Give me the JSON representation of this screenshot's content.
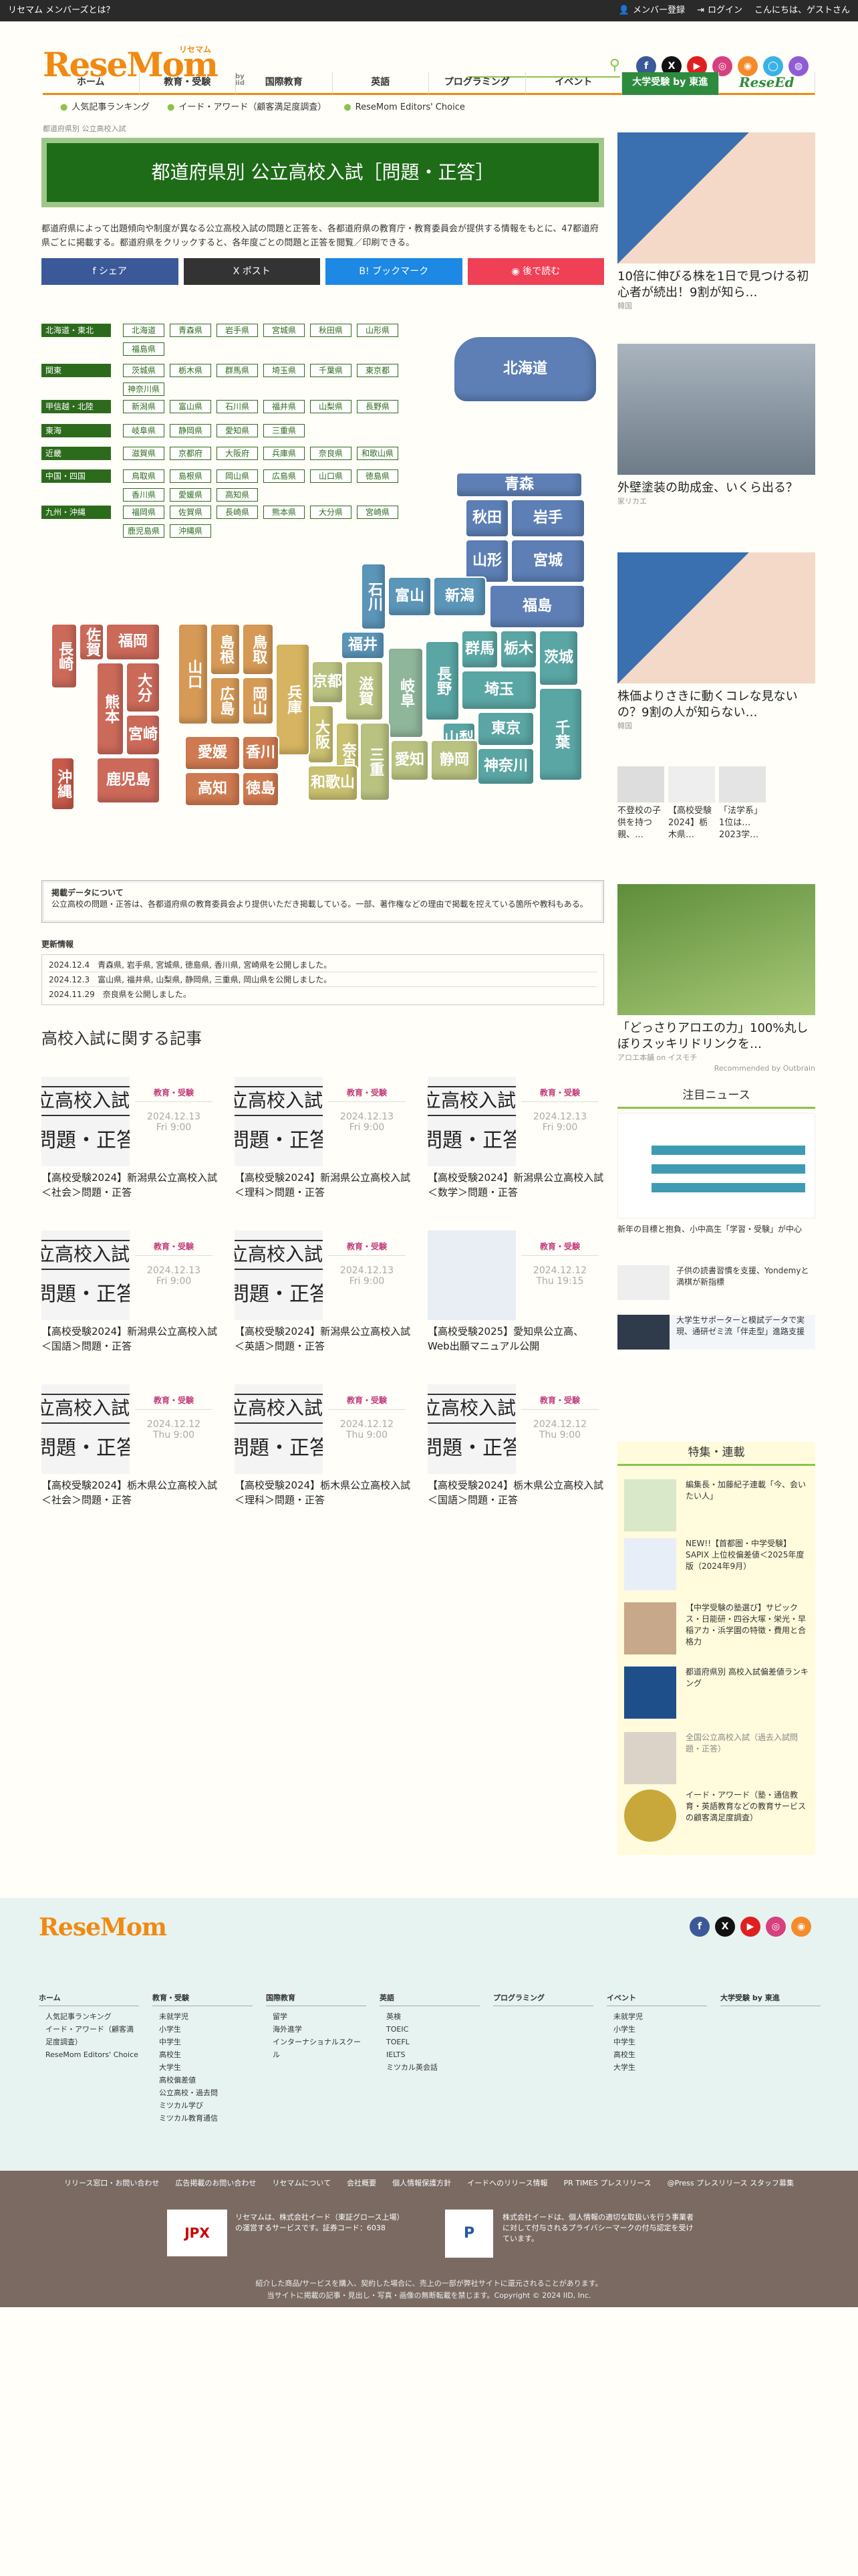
{
  "topbar": {
    "left": "リセマム メンバーズとは？",
    "member": "メンバー登録",
    "login": "ログイン",
    "greeting": "こんにちは、ゲストさん"
  },
  "logo": {
    "text": "ReseMom",
    "kana": "リセマム",
    "by": "by iid"
  },
  "social": [
    "f",
    "X",
    "▶",
    "◎",
    "◉",
    "◯",
    "◍"
  ],
  "nav": [
    {
      "label": "ホーム"
    },
    {
      "label": "教育・受験"
    },
    {
      "label": "国際教育"
    },
    {
      "label": "英語"
    },
    {
      "label": "プログラミング"
    },
    {
      "label": "イベント"
    },
    {
      "label": "大学受験 by 東進"
    },
    {
      "label": "ReseEd"
    }
  ],
  "subnav": [
    "人気記事ランキング",
    "イード・アワード（顧客満足度調査）",
    "ReseMom Editors' Choice"
  ],
  "breadcrumb": "都道府県別 公立高校入試",
  "title": "都道府県別 公立高校入試［問題・正答］",
  "intro": "都道府県によって出題傾向や制度が異なる公立高校入試の問題と正答を、各都道府県の教育庁・教育委員会が提供する情報をもとに、47都道府県ごとに掲載する。都道府県をクリックすると、各年度ごとの問題と正答を閲覧／印刷できる。",
  "share": [
    "f シェア",
    "X ポスト",
    "B! ブックマーク",
    "◉ 後で読む"
  ],
  "regions": [
    {
      "label": "北海道・東北",
      "prefs": [
        "北海道",
        "青森県",
        "岩手県",
        "宮城県",
        "秋田県",
        "山形県",
        "福島県"
      ]
    },
    {
      "label": "関東",
      "prefs": [
        "茨城県",
        "栃木県",
        "群馬県",
        "埼玉県",
        "千葉県",
        "東京都",
        "神奈川県"
      ]
    },
    {
      "label": "甲信越・北陸",
      "prefs": [
        "新潟県",
        "富山県",
        "石川県",
        "福井県",
        "山梨県",
        "長野県"
      ]
    },
    {
      "label": "東海",
      "prefs": [
        "岐阜県",
        "静岡県",
        "愛知県",
        "三重県"
      ]
    },
    {
      "label": "近畿",
      "prefs": [
        "滋賀県",
        "京都府",
        "大阪府",
        "兵庫県",
        "奈良県",
        "和歌山県"
      ]
    },
    {
      "label": "中国・四国",
      "prefs": [
        "鳥取県",
        "島根県",
        "岡山県",
        "広島県",
        "山口県",
        "徳島県",
        "香川県",
        "愛媛県",
        "高知県"
      ]
    },
    {
      "label": "九州・沖縄",
      "prefs": [
        "福岡県",
        "佐賀県",
        "長崎県",
        "熊本県",
        "大分県",
        "宮崎県",
        "鹿児島県",
        "沖縄県"
      ]
    }
  ],
  "map": [
    "北海道",
    "青森",
    "秋田",
    "岩手",
    "山形",
    "宮城",
    "福島",
    "新潟",
    "富山",
    "石川",
    "福井",
    "群馬",
    "栃木",
    "茨城",
    "長野",
    "埼玉",
    "山梨",
    "東京",
    "千葉",
    "神奈川",
    "岐阜",
    "愛知",
    "静岡",
    "滋賀",
    "京都",
    "三重",
    "大阪",
    "奈良",
    "和歌山",
    "兵庫",
    "鳥取",
    "島根",
    "岡山",
    "広島",
    "山口",
    "香川",
    "愛媛",
    "徳島",
    "高知",
    "福岡",
    "佐賀",
    "長崎",
    "大分",
    "熊本",
    "宮崎",
    "鹿児島",
    "沖縄"
  ],
  "info": {
    "title": "掲載データについて",
    "body": "公立高校の問題・正答は、各都道府県の教育委員会より提供いただき掲載している。一部、著作権などの理由で掲載を控えている箇所や教科もある。"
  },
  "updates": {
    "title": "更新情報",
    "rows": [
      "2024.12.4　青森県, 岩手県, 宮城県, 徳島県, 香川県, 宮崎県を公開しました。",
      "2024.12.3　富山県, 福井県, 山梨県, 静岡県, 三重県, 岡山県を公開しました。",
      "2024.11.29　奈良県を公開しました。"
    ]
  },
  "articles_heading": "高校入試に関する記事",
  "articles": [
    {
      "cat": "教育・受験",
      "date": "2024.12.13",
      "day": "Fri 9:00",
      "title": "【高校受験2024】新潟県公立高校入試＜社会＞問題・正答",
      "thumb": "exam"
    },
    {
      "cat": "教育・受験",
      "date": "2024.12.13",
      "day": "Fri 9:00",
      "title": "【高校受験2024】新潟県公立高校入試＜理科＞問題・正答",
      "thumb": "exam"
    },
    {
      "cat": "教育・受験",
      "date": "2024.12.13",
      "day": "Fri 9:00",
      "title": "【高校受験2024】新潟県公立高校入試＜数学＞問題・正答",
      "thumb": "exam"
    },
    {
      "cat": "教育・受験",
      "date": "2024.12.13",
      "day": "Fri 9:00",
      "title": "【高校受験2024】新潟県公立高校入試＜国語＞問題・正答",
      "thumb": "exam"
    },
    {
      "cat": "教育・受験",
      "date": "2024.12.13",
      "day": "Fri 9:00",
      "title": "【高校受験2024】新潟県公立高校入試＜英語＞問題・正答",
      "thumb": "exam"
    },
    {
      "cat": "教育・受験",
      "date": "2024.12.12",
      "day": "Thu 19:15",
      "title": "【高校受験2025】愛知県公立高、Web出願マニュアル公開",
      "thumb": "web"
    },
    {
      "cat": "教育・受験",
      "date": "2024.12.12",
      "day": "Thu 9:00",
      "title": "【高校受験2024】栃木県公立高校入試＜社会＞問題・正答",
      "thumb": "exam"
    },
    {
      "cat": "教育・受験",
      "date": "2024.12.12",
      "day": "Thu 9:00",
      "title": "【高校受験2024】栃木県公立高校入試＜理科＞問題・正答",
      "thumb": "exam"
    },
    {
      "cat": "教育・受験",
      "date": "2024.12.12",
      "day": "Thu 9:00",
      "title": "【高校受験2024】栃木県公立高校入試＜国語＞問題・正答",
      "thumb": "exam"
    }
  ],
  "thumb_text": {
    "line1": "立高校入試",
    "line2": "問題・正答"
  },
  "side_ads": [
    {
      "title": "10倍に伸びる株を1日で見つける初心者が続出！9割が知ら…",
      "src": "韓国",
      "color": "#3a6fb0"
    },
    {
      "title": "外壁塗装の助成金、いくら出る？",
      "src": "家リカエ",
      "color": "#8d9aa6"
    },
    {
      "title": "株価よりさきに動くコレな見ないの？9割の人が知らない…",
      "src": "韓国",
      "color": "#3a6fb0"
    }
  ],
  "small_ads": [
    {
      "title": "不登校の子供を持つ親、…"
    },
    {
      "title": "【高校受験2024】栃木県…"
    },
    {
      "title": "「法学系」1位は…2023学…"
    }
  ],
  "aloe": {
    "title": "「どっさりアロエの力」100%丸しぼりスッキリドリンクを…",
    "src": "アロエ本舗 on イスモチ",
    "rec": "Recommended by Outbrain"
  },
  "news_heading": "注目ニュース",
  "news": [
    {
      "title": "新年の目標と抱負、小中高生「学習・受験」が中心"
    },
    {
      "title": "子供の読書習慣を支援、Yondemyと満棋が新指標"
    },
    {
      "title": "大学生サポーターと模試データで実現、通研ゼミ流「伴走型」進路支援"
    }
  ],
  "feature_heading": "特集・連載",
  "features": [
    {
      "title": "編集長・加藤紀子連載「今、会いたい人」"
    },
    {
      "title": "NEW!!【首都圏・中学受験】SAPIX 上位校偏差値＜2025年度版（2024年9月）"
    },
    {
      "title": "【中学受験の塾選び】サピックス・日能研・四谷大塚・栄光・早稲アカ・浜学園の特徴・費用と合格力"
    },
    {
      "title": "都道府県別 高校入試偏差値ランキング"
    },
    {
      "title": "全国公立高校入試（過去入試問題・正答）"
    },
    {
      "title": "イード・アワード（塾・通信教育・英語教育などの教育サービスの顧客満足度調査）"
    }
  ],
  "footer": {
    "logo": "ReseMom",
    "cols": [
      {
        "h": "ホーム",
        "items": [
          "人気記事ランキング",
          "イード・アワード（顧客満足度調査）",
          "ReseMom Editors' Choice"
        ]
      },
      {
        "h": "教育・受験",
        "items": [
          "未就学児",
          "小学生",
          "中学生",
          "高校生",
          "大学生",
          "高校偏差値",
          "公立高校・過去問",
          "ミツカル学び",
          "ミツカル教育通信"
        ]
      },
      {
        "h": "国際教育",
        "items": [
          "留学",
          "海外進学",
          "インターナショナルスクール"
        ]
      },
      {
        "h": "英語",
        "items": [
          "英検",
          "TOEIC",
          "TOEFL",
          "IELTS",
          "ミツカル英会話"
        ]
      },
      {
        "h": "プログラミング",
        "items": []
      },
      {
        "h": "イベント",
        "items": [
          "未就学児",
          "小学生",
          "中学生",
          "高校生",
          "大学生"
        ]
      },
      {
        "h": "大学受験 by 東進",
        "items": []
      }
    ],
    "links": [
      "リリース窓口・お問い合わせ",
      "広告掲載のお問い合わせ",
      "リセマムについて",
      "会社概要",
      "個人情報保護方針",
      "イードへのリリース情報",
      "PR TIMES プレスリリース",
      "@Press プレスリリース スタッフ募集"
    ],
    "jpx": "JPX",
    "jpx_text": "リセマムは、株式会社イード（東証グロース上場）の運営するサービスです。証券コード：6038",
    "privacy": "P",
    "privacy_text": "株式会社イードは、個人情報の適切な取扱いを行う事業者に対して付与されるプライバシーマークの付与認定を受けています。",
    "copy1": "紹介した商品/サービスを購入、契約した場合に、売上の一部が弊社サイトに還元されることがあります。",
    "copy2": "当サイトに掲載の記事・見出し・写真・画像の無断転載を禁じます。Copyright © 2024 IID, Inc."
  }
}
